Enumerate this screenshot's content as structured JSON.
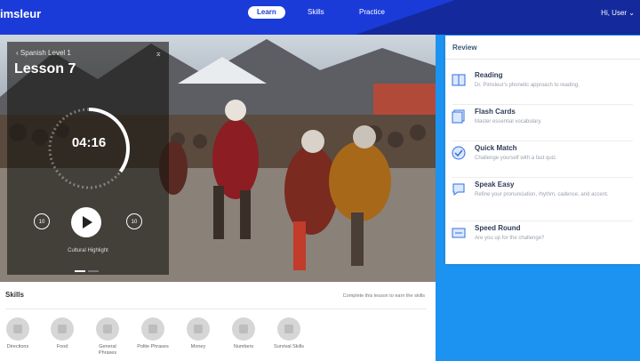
{
  "header": {
    "logo": "imsleur",
    "nav": [
      {
        "label": "Learn",
        "active": true
      },
      {
        "label": "Skills",
        "active": false
      },
      {
        "label": "Practice",
        "active": false
      }
    ],
    "user_greeting": "Hi, User"
  },
  "lesson": {
    "breadcrumb": "Spanish Level 1",
    "title": "Lesson 7",
    "timer": "04:16",
    "progress_fraction": 0.35,
    "rewind_label": "10",
    "forward_label": "10",
    "caption": "Cultural Highlight",
    "slides": 2,
    "active_slide": 0
  },
  "review": {
    "title": "Review",
    "items": [
      {
        "label": "Reading",
        "desc": "Dr. Pimsleur's phonetic approach to reading.",
        "icon": "book-icon"
      },
      {
        "label": "Flash Cards",
        "desc": "Master essential vocabulary.",
        "icon": "cards-icon"
      },
      {
        "label": "Quick Match",
        "desc": "Challenge yourself with a fast quiz.",
        "icon": "check-circle-icon"
      },
      {
        "label": "Speak Easy",
        "desc": "Refine your pronunciation, rhythm, cadence, and accent.",
        "icon": "speech-bubble-icon"
      },
      {
        "label": "Speed Round",
        "desc": "Are you up for the challenge?",
        "icon": "timer-icon"
      }
    ]
  },
  "skills": {
    "title": "Skills",
    "hint": "Complete this lesson to earn the skills",
    "items": [
      {
        "label": "Directions"
      },
      {
        "label": "Food"
      },
      {
        "label": "General Phrases"
      },
      {
        "label": "Polite Phrases"
      },
      {
        "label": "Money"
      },
      {
        "label": "Numbers"
      },
      {
        "label": "Survival Skills"
      }
    ]
  },
  "colors": {
    "header_blue": "#1b3bd9",
    "accent_blue": "#1c93f0",
    "icon_blue": "#2f6fe0"
  }
}
